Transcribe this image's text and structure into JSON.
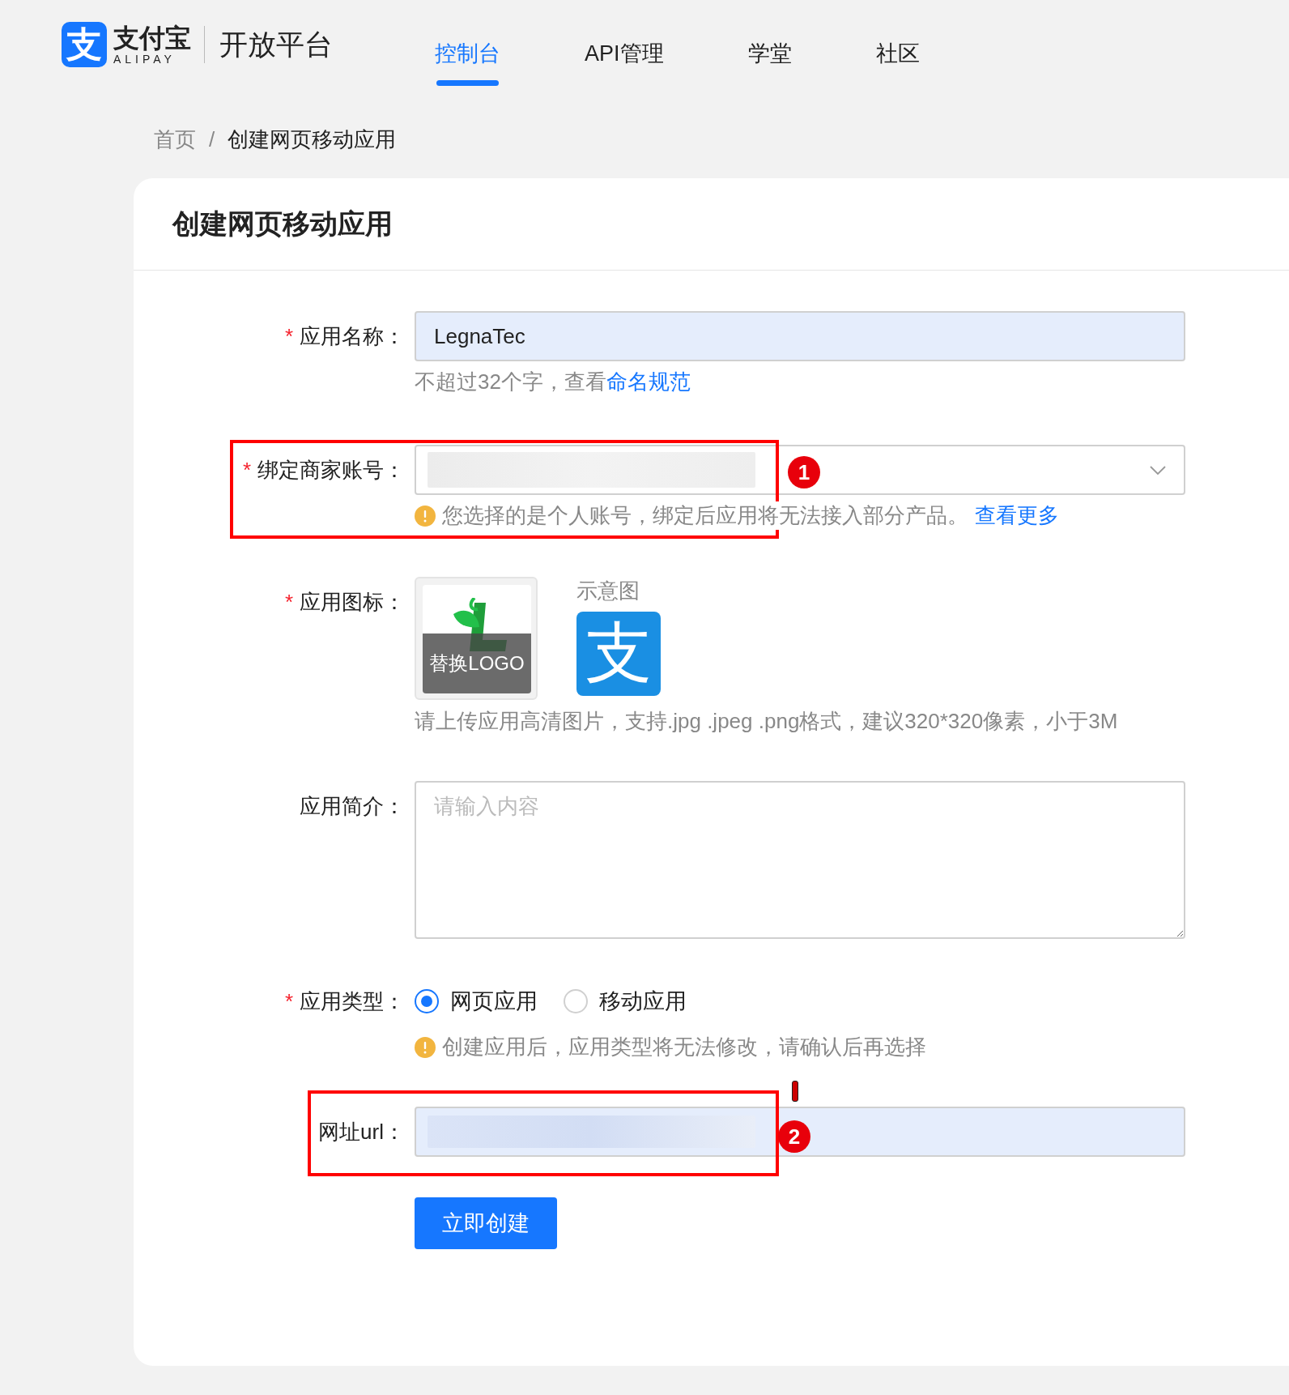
{
  "header": {
    "logo_mark": "支",
    "logo_name": "支付宝",
    "logo_sub": "ALIPAY",
    "platform": "开放平台",
    "nav": [
      {
        "label": "控制台",
        "selected": true
      },
      {
        "label": "API管理",
        "selected": false
      },
      {
        "label": "学堂",
        "selected": false
      },
      {
        "label": "社区",
        "selected": false
      }
    ]
  },
  "breadcrumb": {
    "items": [
      "首页",
      "创建网页移动应用"
    ],
    "separator": "/"
  },
  "card": {
    "title": "创建网页移动应用",
    "required_mark": "*",
    "fields": [
      {
        "kind": "text",
        "required": true,
        "label": "应用名称：",
        "value": "LegnaTec",
        "hint": "不超过32个字，查看",
        "hint_link": "命名规范"
      },
      {
        "kind": "select",
        "required": true,
        "label": "绑定商家账号：",
        "warning": "您选择的是个人账号，绑定后应用将无法接入部分产品。",
        "warning_link": "查看更多",
        "annotation": "1"
      },
      {
        "kind": "upload",
        "required": true,
        "label": "应用图标：",
        "overlay": "替换LOGO",
        "preview_label": "示意图",
        "preview_mark": "支",
        "hint": "请上传应用高清图片，支持.jpg .jpeg .png格式，建议320*320像素，小于3M"
      },
      {
        "kind": "textarea",
        "required": false,
        "label": "应用简介：",
        "placeholder": "请输入内容"
      },
      {
        "kind": "radio",
        "required": true,
        "label": "应用类型：",
        "options": [
          {
            "label": "网页应用",
            "selected": true
          },
          {
            "label": "移动应用",
            "selected": false
          }
        ],
        "warning": "创建应用后，应用类型将无法修改，请确认后再选择"
      },
      {
        "kind": "url",
        "required": false,
        "label": "网址url：",
        "annotation": "2"
      }
    ],
    "submit": "立即创建"
  }
}
